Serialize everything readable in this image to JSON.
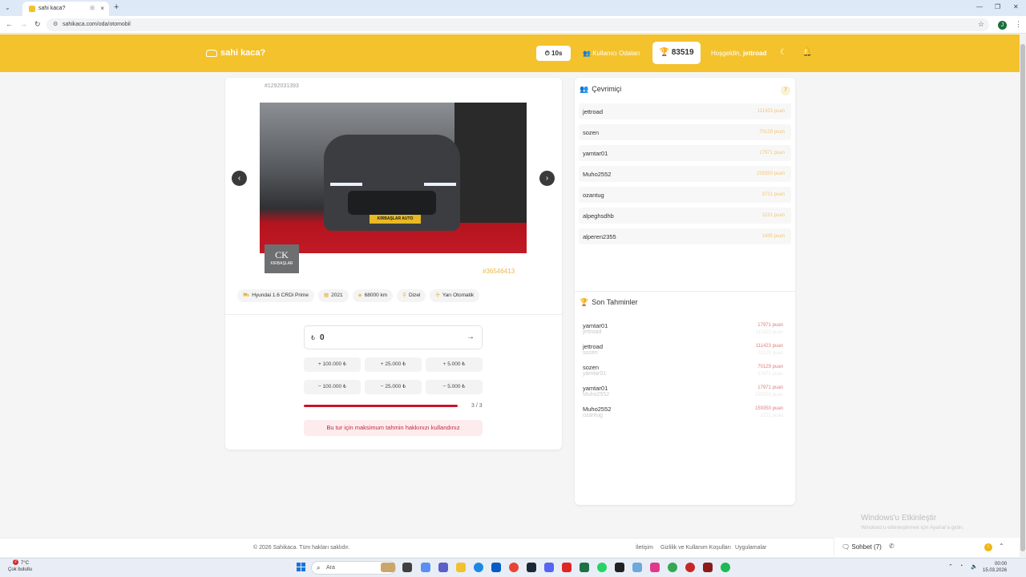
{
  "browser": {
    "tab_title": "sahi kaca?",
    "url": "sahikaca.com/oda/otomobil",
    "profile_initial": "J"
  },
  "header": {
    "logo_text": "sahi kaca?",
    "timer": "10s",
    "users_room": "Kullanıcı Odaları",
    "score": "83519",
    "welcome_prefix": "Hoşgeldin,",
    "username": "jettroad"
  },
  "listing": {
    "id": "#1292031393",
    "ad_number": "#36546413",
    "plate_text": "KIRBAŞLAR AUTO",
    "dealer_mono": "CK",
    "dealer_name": "KIRBAŞLAR",
    "chips": [
      {
        "icon": "car-icon",
        "glyph": "⛟",
        "label": "Hyundai 1.6 CRDi Prime"
      },
      {
        "icon": "calendar-icon",
        "glyph": "▦",
        "label": "2021"
      },
      {
        "icon": "gauge-icon",
        "glyph": "◈",
        "label": "68000 km"
      },
      {
        "icon": "fuel-icon",
        "glyph": "⚲",
        "label": "Dizel"
      },
      {
        "icon": "gear-shift-icon",
        "glyph": "✣",
        "label": "Yarı Otomatik"
      }
    ]
  },
  "guess": {
    "currency": "₺",
    "value": "0",
    "increments": [
      "+ 100.000 ₺",
      "+ 25.000 ₺",
      "+ 5.000 ₺"
    ],
    "decrements": [
      "− 100.000 ₺",
      "− 25.000 ₺",
      "− 5.000 ₺"
    ],
    "attempts_used": 3,
    "attempts_total": 3,
    "progress_text": "3 / 3",
    "limit_message": "Bu tur için maksimum tahmin hakkınızı kullandınız"
  },
  "online": {
    "title": "Çevrimiçi",
    "count": "7",
    "users": [
      {
        "name": "jettroad",
        "points": "111423 puan"
      },
      {
        "name": "sozen",
        "points": "70129 puan"
      },
      {
        "name": "yamtar01",
        "points": "17971 puan"
      },
      {
        "name": "Muho2552",
        "points": "159350 puan"
      },
      {
        "name": "ozantug",
        "points": "3721 puan"
      },
      {
        "name": "alpeghsdhb",
        "points": "1131 puan"
      },
      {
        "name": "alperen2355",
        "points": "1435 puan"
      }
    ]
  },
  "recent": {
    "title": "Son Tahminler",
    "guesses": [
      {
        "name": "yamtar01",
        "points": "17971 puan",
        "ghost": "jettroad",
        "ghost_points": "111423 puan"
      },
      {
        "name": "jettroad",
        "points": "111423 puan",
        "ghost": "sozen",
        "ghost_points": "70129 puan"
      },
      {
        "name": "sozen",
        "points": "70129 puan",
        "ghost": "yamtar01",
        "ghost_points": "17971 puan"
      },
      {
        "name": "yamtar01",
        "points": "17971 puan",
        "ghost": "Muho2552",
        "ghost_points": "159350 puan"
      },
      {
        "name": "Muho2552",
        "points": "159350 puan",
        "ghost": "ozantug",
        "ghost_points": "3721 puan"
      }
    ]
  },
  "watermark": {
    "line1": "Windows'u Etkinleştir",
    "line2": "Windows'u etkinleştirmek için Ayarlar'a gidin."
  },
  "footer": {
    "copyright": "© 2026 Sahikaca. Tüm hakları saklıdır.",
    "links": [
      "İletişim",
      "Gizlilik ve Kullanım Koşulları",
      "Uygulamalar"
    ],
    "chat_label": "Sohbet (7)",
    "notif_count": "!"
  },
  "taskbar": {
    "weather_temp": "7°C",
    "weather_desc": "Çok bulutlu",
    "weather_badge": "2",
    "search_placeholder": "Ara",
    "time": "00:00",
    "date": "15.03.2026"
  },
  "colors": {
    "brand": "#f3c22c",
    "danger": "#c8142c",
    "accent": "#e9b84a"
  }
}
